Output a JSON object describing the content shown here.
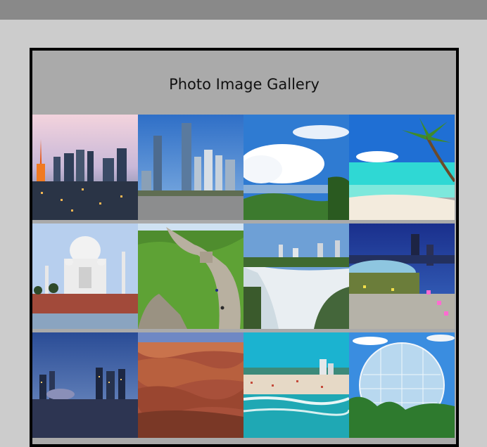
{
  "gallery": {
    "title": "Photo Image Gallery",
    "photos": [
      {
        "subject": "Tokyo skyline with tower at dusk"
      },
      {
        "subject": "City skyscrapers by river"
      },
      {
        "subject": "Green hills under blue sky with clouds"
      },
      {
        "subject": "Tropical beach with palm tree"
      },
      {
        "subject": "Taj Mahal"
      },
      {
        "subject": "Great Wall of China"
      },
      {
        "subject": "Niagara Falls"
      },
      {
        "subject": "Illuminated dome stadium at night"
      },
      {
        "subject": "Singapore skyline at night"
      },
      {
        "subject": "Grand Canyon"
      },
      {
        "subject": "Crowded beach with turquoise sea"
      },
      {
        "subject": "Geodesic sphere among trees"
      }
    ]
  }
}
